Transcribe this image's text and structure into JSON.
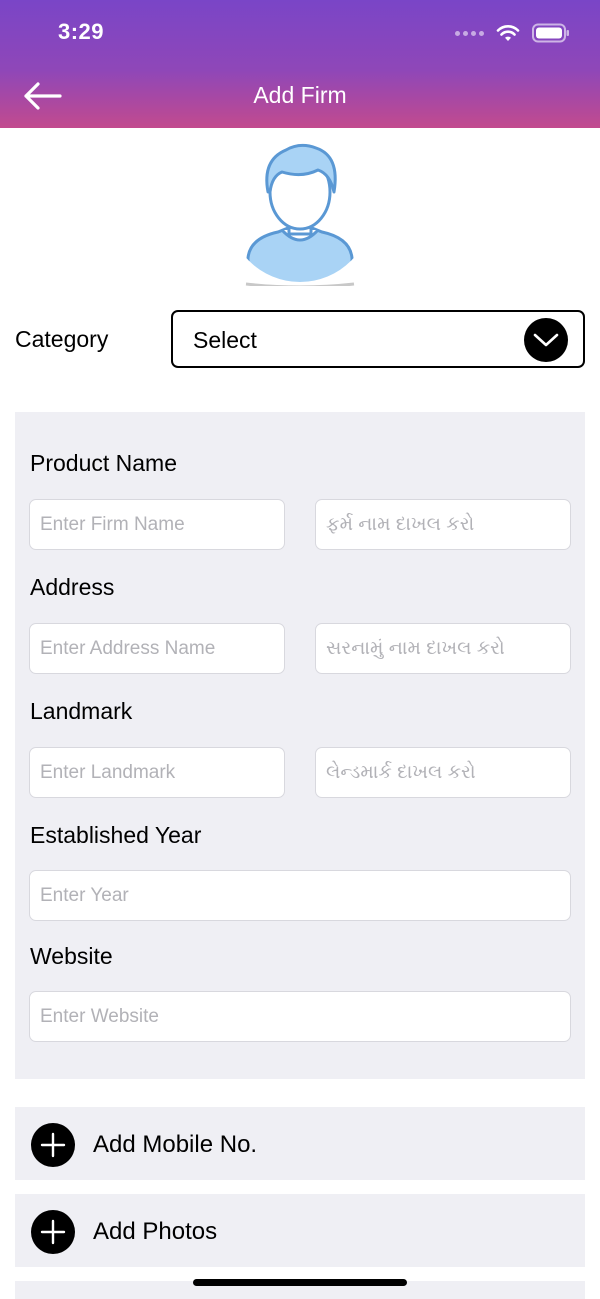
{
  "status_bar": {
    "time": "3:29"
  },
  "header": {
    "title": "Add Firm"
  },
  "category": {
    "label": "Category",
    "selected": "Select"
  },
  "form": {
    "product_name": {
      "label": "Product Name",
      "placeholder_en": "Enter Firm Name",
      "placeholder_gu": "ફર્મ નામ દાખલ કરો"
    },
    "address": {
      "label": "Address",
      "placeholder_en": "Enter Address Name",
      "placeholder_gu": "સરનામું નામ દાખલ કરો"
    },
    "landmark": {
      "label": "Landmark",
      "placeholder_en": "Enter Landmark",
      "placeholder_gu": "લેન્ડમાર્ક દાખલ કરો"
    },
    "established_year": {
      "label": "Established Year",
      "placeholder": "Enter Year"
    },
    "website": {
      "label": "Website",
      "placeholder": "Enter Website"
    }
  },
  "actions": {
    "add_mobile": "Add Mobile No.",
    "add_photos": "Add Photos"
  },
  "icons": {
    "back": "back-arrow-icon",
    "chevron": "chevron-down-icon",
    "plus": "plus-icon",
    "avatar": "user-avatar-icon",
    "wifi": "wifi-icon",
    "battery": "battery-icon"
  },
  "colors": {
    "header_top": "#7a45c7",
    "header_bottom": "#c24a8e",
    "panel_bg": "#efeff4",
    "placeholder": "#b2b2b7",
    "avatar_blue": "#a9d3f5"
  }
}
